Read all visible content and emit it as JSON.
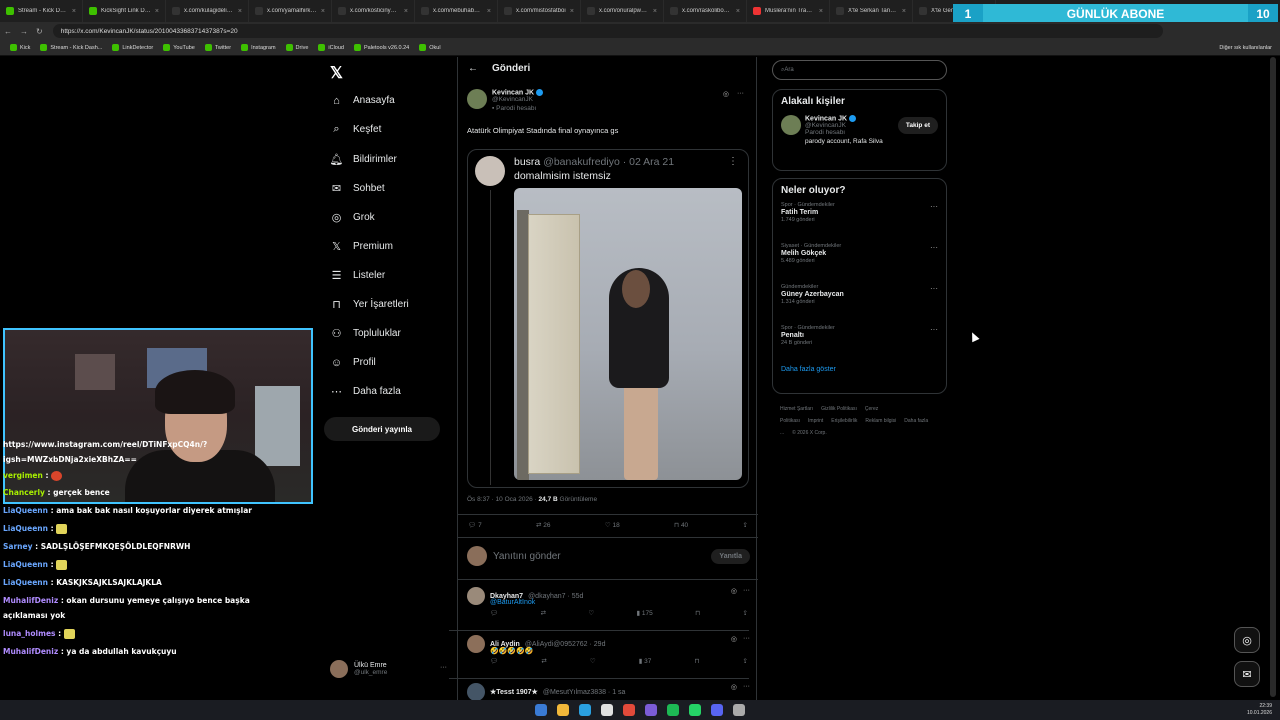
{
  "browser": {
    "tabs": [
      {
        "label": "Stream - Kick Dashb",
        "icon": "kick"
      },
      {
        "label": "KickSight Link Detec",
        "icon": "kick"
      },
      {
        "label": "x.com/kulagidelikli/s",
        "icon": "x"
      },
      {
        "label": "x.com/yamalhirka/s",
        "icon": "x"
      },
      {
        "label": "x.com/kosticinyar5a",
        "icon": "x"
      },
      {
        "label": "x.com/nebuhaber/st",
        "icon": "x"
      },
      {
        "label": "x.com/mistosfatboi",
        "icon": "x"
      },
      {
        "label": "x.com/onuralpwash",
        "icon": "x"
      },
      {
        "label": "x.com/raskolibov/sta",
        "icon": "x"
      },
      {
        "label": "Muslera'nın Trabzon",
        "icon": "youtube"
      },
      {
        "label": "X'te Serkan Tanyıldı",
        "icon": "x"
      },
      {
        "label": "X'te Genç Şenol",
        "icon": "x"
      }
    ],
    "url": "https://x.com/KevincanJK/status/2010043368371437387s=20",
    "bookmarks": [
      "Kick",
      "Stream - Kick Dash...",
      "LinkDetector",
      "YouTube",
      "Twitter",
      "Instagram",
      "Drive",
      "iCloud",
      "Paletools v26.0.24",
      "Okul"
    ],
    "bookmarks_right": "Diğer sık kullanılanlar",
    "profile_button": "Sohbet et"
  },
  "overlay": {
    "abone_left": "1",
    "abone_label": "GÜNLÜK ABONE",
    "abone_right": "10"
  },
  "x_nav": {
    "items": [
      {
        "label": "Anasayfa",
        "icon": "home-icon"
      },
      {
        "label": "Keşfet",
        "icon": "search-icon"
      },
      {
        "label": "Bildirimler",
        "icon": "bell-icon"
      },
      {
        "label": "Sohbet",
        "icon": "mail-icon"
      },
      {
        "label": "Grok",
        "icon": "grok-icon"
      },
      {
        "label": "Premium",
        "icon": "x-icon"
      },
      {
        "label": "Listeler",
        "icon": "list-icon"
      },
      {
        "label": "Yer İşaretleri",
        "icon": "bookmark-icon"
      },
      {
        "label": "Topluluklar",
        "icon": "people-icon"
      },
      {
        "label": "Profil",
        "icon": "person-icon"
      },
      {
        "label": "Daha fazla",
        "icon": "more-icon"
      }
    ],
    "post_button": "Gönderi yayınla",
    "account": {
      "name": "Ülkü Emre",
      "handle": "@ulk_emre"
    }
  },
  "post": {
    "header": "Gönderi",
    "author": "Kevincan JK",
    "handle": "@KevincanJK",
    "badge": "Parodi hesabı",
    "text": "Atatürk Olimpiyat Stadında final oynayınca gs",
    "quote": {
      "name": "busra",
      "handle": "@banakufrediyo",
      "date": "02 Ara 21",
      "text": "domalmisim istemsiz"
    },
    "time": "Ös 8:37 · 10 Oca 2026 · ",
    "views": "24,7 B",
    "views_label": " Görüntüleme",
    "stats": {
      "replies": "7",
      "reposts": "26",
      "likes": "18",
      "bookmarks": "40"
    },
    "reply_placeholder": "Yanıtını gönder",
    "reply_button": "Yanıtla"
  },
  "replies": [
    {
      "name": "Dkayhan7",
      "handle": "@dkayhan7 · 55d",
      "text": "@BaturAltInok",
      "views": "175"
    },
    {
      "name": "Ali Aydin",
      "handle": "@AliAydi@0952762 · 29d",
      "text": "🤣🤣🤣🤣🤣",
      "views": "37"
    },
    {
      "name": "★Tesst 1907★",
      "handle": "@MesutYılmaz3838 · 1 sa",
      "text": "",
      "views": ""
    }
  ],
  "right": {
    "search_placeholder": "Ara",
    "related_title": "Alakalı kişiler",
    "related": {
      "name": "Kevincan JK",
      "handle": "@KevincanJK",
      "badge": "Parodi hesabı",
      "bio": "parody account, Rafa Silva",
      "follow": "Takip et"
    },
    "trends_title": "Neler oluyor?",
    "trends": [
      {
        "category": "Spor · Gündemdekiler",
        "name": "Fatih Terim",
        "posts": "1.749 gönderi"
      },
      {
        "category": "Siyaset · Gündemdekiler",
        "name": "Melih Gökçek",
        "posts": "5.489 gönderi"
      },
      {
        "category": "Gündemdekiler",
        "name": "Güney Azerbaycan",
        "posts": "1.314 gönderi"
      },
      {
        "category": "Spor · Gündemdekiler",
        "name": "Penaltı",
        "posts": "24 B gönderi"
      }
    ],
    "show_more": "Daha fazla göster",
    "footer": [
      "Hizmet Şartları",
      "Gizlilik Politikası",
      "Çerez Politikası",
      "Imprint",
      "Erişilebilirlik",
      "Reklam bilgisi",
      "Daha fazla ...",
      "© 2026 X Corp."
    ]
  },
  "chat": [
    {
      "user": "",
      "text": "https://www.instagram.com/reel/DTiNFxpCQ4n/?"
    },
    {
      "user": "",
      "text": "igsh=MWZxbDNja2xieXBhZA=="
    },
    {
      "user": "vergimen",
      "text": " : "
    },
    {
      "user": "Chancerly",
      "text": " : gerçek bence"
    },
    {
      "user": "LiaQueenn",
      "text": " : ama bak bak nasıl koşuyorlar diyerek atmışlar"
    },
    {
      "user": "LiaQueenn",
      "text": " : "
    },
    {
      "user": "Sarney",
      "text": " : SADLŞLÖŞEFMKQEŞÖLDLEQFNRWH"
    },
    {
      "user": "LiaQueenn",
      "text": " : "
    },
    {
      "user": "LiaQueenn",
      "text": " : KASKJKSAJKLSAJKLAJKLA"
    },
    {
      "user": "MuhalifDeniz",
      "text": " : okan dursunu yemeye çalışıyo bence başka"
    },
    {
      "user": "",
      "text": "açıklaması yok"
    },
    {
      "user": "luna_holmes",
      "text": " : "
    },
    {
      "user": "MuhalifDeniz",
      "text": " : ya da abdullah kavukçuyu"
    }
  ],
  "taskbar": {
    "time": "22:39",
    "date": "10.01.2026"
  }
}
